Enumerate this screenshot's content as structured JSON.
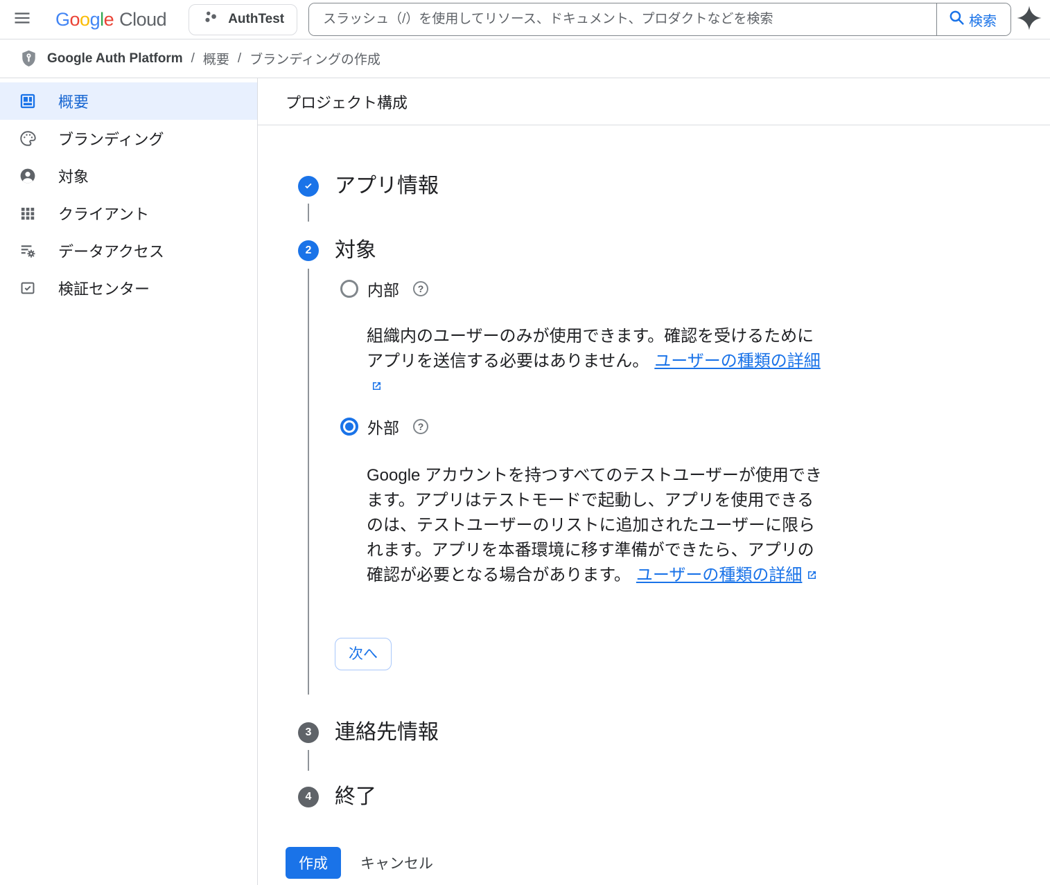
{
  "topbar": {
    "logo": {
      "letters": [
        {
          "ch": "G"
        },
        {
          "ch": "o"
        },
        {
          "ch": "o"
        },
        {
          "ch": "g"
        },
        {
          "ch": "l"
        },
        {
          "ch": "e"
        }
      ],
      "suffix": "Cloud"
    },
    "project_name": "AuthTest",
    "search_placeholder": "スラッシュ（/）を使用してリソース、ドキュメント、プロダクトなどを検索",
    "search_value": "",
    "search_button_label": "検索"
  },
  "breadcrumb": {
    "product": "Google Auth Platform",
    "separator": "/",
    "items": [
      "概要",
      "ブランディングの作成"
    ]
  },
  "sidebar": {
    "items": [
      {
        "label": "概要",
        "icon": "dashboard-icon",
        "selected": true
      },
      {
        "label": "ブランディング",
        "icon": "palette-icon",
        "selected": false
      },
      {
        "label": "対象",
        "icon": "person-icon",
        "selected": false
      },
      {
        "label": "クライアント",
        "icon": "apps-grid-icon",
        "selected": false
      },
      {
        "label": "データアクセス",
        "icon": "data-access-icon",
        "selected": false
      },
      {
        "label": "検証センター",
        "icon": "verification-icon",
        "selected": false
      }
    ]
  },
  "main": {
    "page_title": "プロジェクト構成",
    "steps": [
      {
        "number": "1",
        "label": "アプリ情報",
        "state": "completed"
      },
      {
        "number": "2",
        "label": "対象",
        "state": "active"
      },
      {
        "number": "3",
        "label": "連絡先情報",
        "state": "pending"
      },
      {
        "number": "4",
        "label": "終了",
        "state": "pending"
      }
    ],
    "audience": {
      "options": [
        {
          "label": "内部",
          "selected": false,
          "description": "組織内のユーザーのみが使用できます。確認を受けるためにアプリを送信する必要はありません。",
          "link_label": "ユーザーの種類の詳細"
        },
        {
          "label": "外部",
          "selected": true,
          "description": "Google アカウントを持つすべてのテストユーザーが使用できます。アプリはテストモードで起動し、アプリを使用できるのは、テストユーザーのリストに追加されたユーザーに限られます。アプリを本番環境に移す準備ができたら、アプリの確認が必要となる場合があります。",
          "link_label": "ユーザーの種類の詳細"
        }
      ],
      "next_button_label": "次へ"
    },
    "create_button_label": "作成",
    "cancel_button_label": "キャンセル"
  },
  "icons": {
    "help_glyph": "?"
  },
  "colors": {
    "primary": "#1a73e8",
    "selected_item_bg": "#e8f0fe",
    "selected_item_text": "#1967d2",
    "text_primary": "#202124",
    "text_secondary": "#5f6368",
    "border": "#dadce0",
    "pending_step": "#5f6368",
    "google_logo_letters": [
      "#4285F4",
      "#EA4335",
      "#FBBC05",
      "#4285F4",
      "#34A853",
      "#EA4335"
    ]
  }
}
